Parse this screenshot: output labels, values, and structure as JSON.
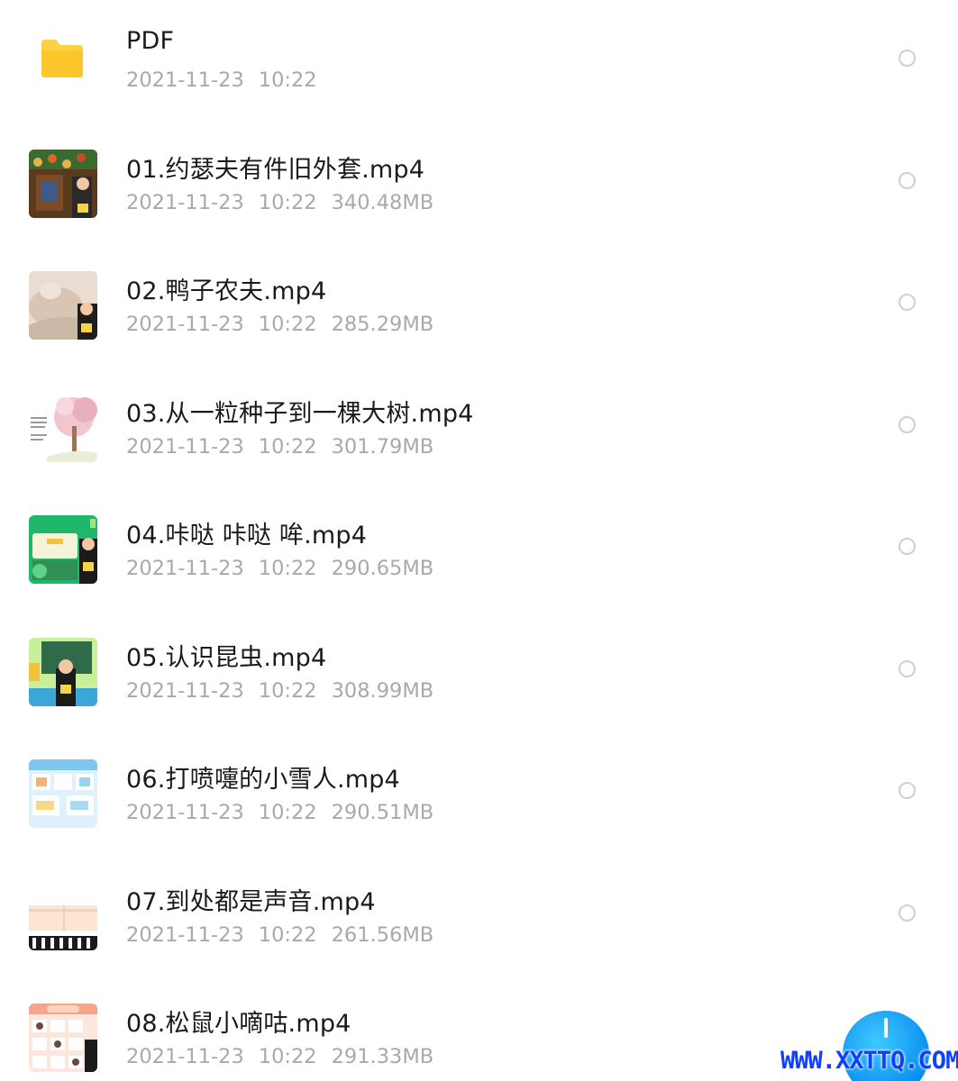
{
  "files": [
    {
      "name": "PDF",
      "date": "2021-11-23",
      "time": "10:22",
      "size": "",
      "thumbnail": "folder-icon"
    },
    {
      "name": "01.约瑟夫有件旧外套.mp4",
      "date": "2021-11-23",
      "time": "10:22",
      "size": "340.48MB",
      "thumbnail": "video-thumbnail"
    },
    {
      "name": "02.鸭子农夫.mp4",
      "date": "2021-11-23",
      "time": "10:22",
      "size": "285.29MB",
      "thumbnail": "video-thumbnail"
    },
    {
      "name": "03.从一粒种子到一棵大树.mp4",
      "date": "2021-11-23",
      "time": "10:22",
      "size": "301.79MB",
      "thumbnail": "video-thumbnail"
    },
    {
      "name": "04.咔哒 咔哒 哞.mp4",
      "date": "2021-11-23",
      "time": "10:22",
      "size": "290.65MB",
      "thumbnail": "video-thumbnail"
    },
    {
      "name": "05.认识昆虫.mp4",
      "date": "2021-11-23",
      "time": "10:22",
      "size": "308.99MB",
      "thumbnail": "video-thumbnail"
    },
    {
      "name": "06.打喷嚏的小雪人.mp4",
      "date": "2021-11-23",
      "time": "10:22",
      "size": "290.51MB",
      "thumbnail": "video-thumbnail"
    },
    {
      "name": "07.到处都是声音.mp4",
      "date": "2021-11-23",
      "time": "10:22",
      "size": "261.56MB",
      "thumbnail": "video-thumbnail"
    },
    {
      "name": "08.松鼠小嘀咕.mp4",
      "date": "2021-11-23",
      "time": "10:22",
      "size": "291.33MB",
      "thumbnail": "video-thumbnail"
    }
  ],
  "watermark": "WWW.XXTTQ.COM",
  "colors": {
    "folder": "#fdd240",
    "fab": "#0a8ff0",
    "watermark": "#1040ff",
    "meta_text": "#a9a9a9"
  }
}
